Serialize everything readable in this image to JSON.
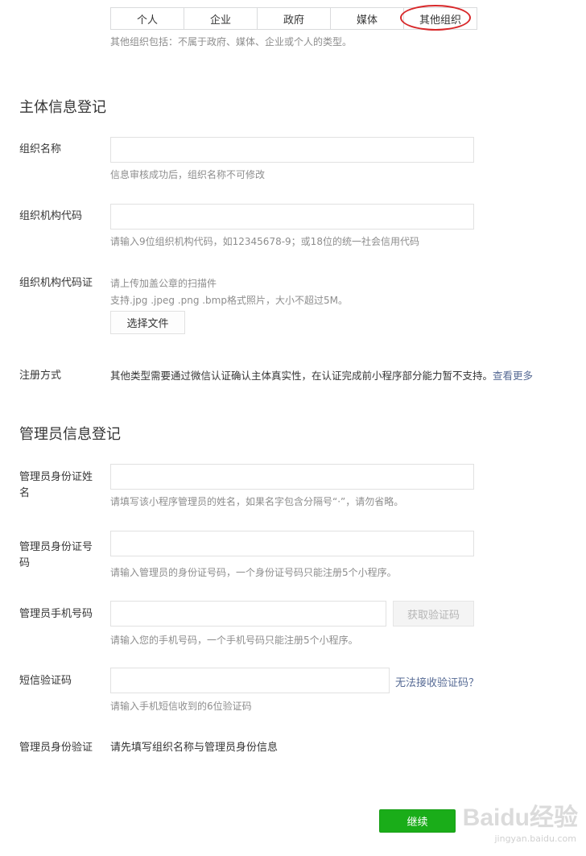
{
  "type_tabs": {
    "items": [
      "个人",
      "企业",
      "政府",
      "媒体",
      "其他组织"
    ],
    "selected_index": 4,
    "hint": "其他组织包括：不属于政府、媒体、企业或个人的类型。"
  },
  "subject_section": {
    "title": "主体信息登记",
    "org_name": {
      "label": "组织名称",
      "value": "",
      "hint": "信息审核成功后，组织名称不可修改"
    },
    "org_code": {
      "label": "组织机构代码",
      "value": "",
      "hint": "请输入9位组织机构代码，如12345678-9；或18位的统一社会信用代码"
    },
    "org_certificate": {
      "label": "组织机构代码证",
      "hint1": "请上传加盖公章的扫描件",
      "hint2": "支持.jpg .jpeg .png .bmp格式照片，大小不超过5M。",
      "button": "选择文件"
    },
    "register_method": {
      "label": "注册方式",
      "text": "其他类型需要通过微信认证确认主体真实性，在认证完成前小程序部分能力暂不支持。",
      "link": "查看更多"
    }
  },
  "admin_section": {
    "title": "管理员信息登记",
    "admin_name": {
      "label": "管理员身份证姓名",
      "value": "",
      "hint": "请填写该小程序管理员的姓名，如果名字包含分隔号“·”，请勿省略。"
    },
    "admin_id": {
      "label": "管理员身份证号码",
      "value": "",
      "hint": "请输入管理员的身份证号码，一个身份证号码只能注册5个小程序。"
    },
    "admin_phone": {
      "label": "管理员手机号码",
      "value": "",
      "button": "获取验证码",
      "hint": "请输入您的手机号码，一个手机号码只能注册5个小程序。"
    },
    "sms_code": {
      "label": "短信验证码",
      "value": "",
      "link": "无法接收验证码？",
      "hint": "请输入手机短信收到的6位验证码"
    },
    "admin_verify": {
      "label": "管理员身份验证",
      "text": "请先填写组织名称与管理员身份信息"
    }
  },
  "continue_button": "继续",
  "watermark": {
    "text": "Baidu经验",
    "sub": "jingyan.baidu.com"
  },
  "colors": {
    "primary": "#1aad19",
    "link": "#576b95",
    "highlight_ring": "#d8282a"
  }
}
